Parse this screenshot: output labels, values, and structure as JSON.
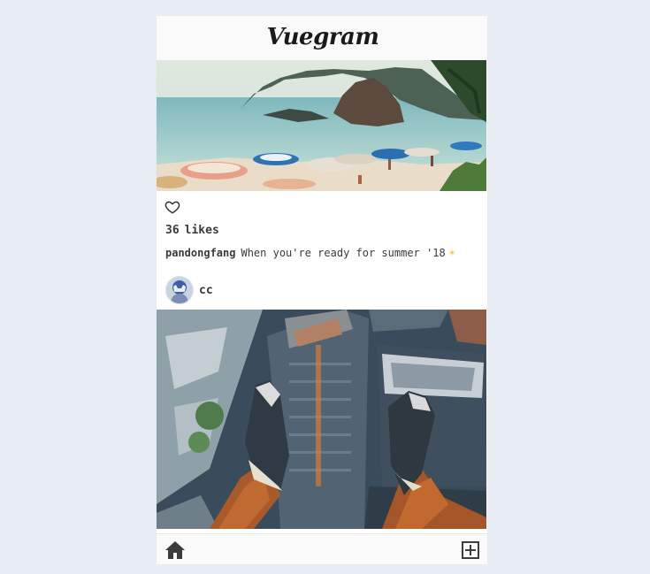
{
  "header": {
    "logo_text": "Vuegram"
  },
  "posts": [
    {
      "image_alt": "beach",
      "likes_count": "36",
      "likes_label": "likes",
      "username": "pandongfang",
      "caption": "When you're ready for summer '18",
      "caption_emoji": "☀"
    },
    {
      "username": "cc",
      "image_alt": "city"
    }
  ],
  "nav": {
    "home_icon": "home-icon",
    "add_icon": "plus-square-icon"
  }
}
